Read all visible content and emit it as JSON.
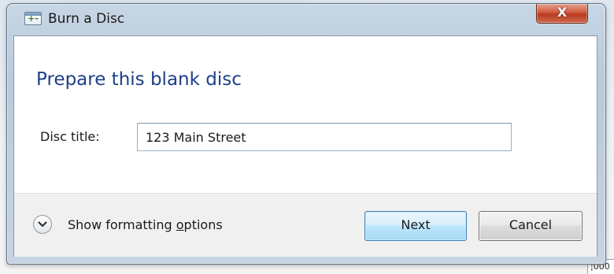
{
  "window": {
    "title": "Burn a Disc",
    "close_glyph": "X"
  },
  "main": {
    "heading": "Prepare this blank disc",
    "disc_title_label": "Disc title:",
    "disc_title_value": "123 Main Street"
  },
  "footer": {
    "formatting_toggle": {
      "label_before": "Show formatting ",
      "label_underlined": "o",
      "label_after": "ptions",
      "icon": "chevron-down-icon"
    },
    "next_label": "Next",
    "cancel_label": "Cancel"
  },
  "background": {
    "edge_text": "¦000"
  },
  "colors": {
    "heading": "#1e3f8a",
    "close_button": "#c8452a",
    "default_button_border": "#3c7fb1"
  }
}
